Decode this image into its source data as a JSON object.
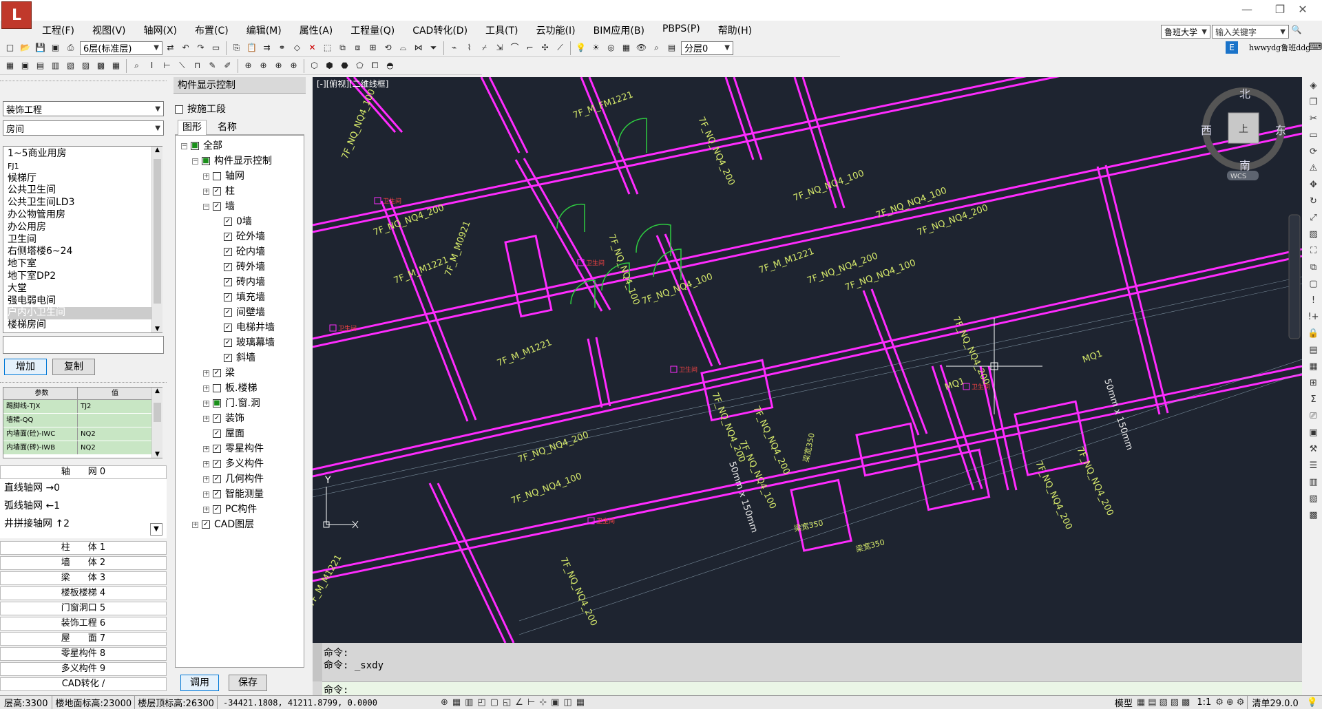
{
  "app": {
    "search_scope": "鲁班大学",
    "search_placeholder": "输入关键字",
    "user_name": "hwwydg鲁班ddg",
    "user_badge": "E"
  },
  "menu": [
    "工程(F)",
    "视图(V)",
    "轴网(X)",
    "布置(C)",
    "编辑(M)",
    "属性(A)",
    "工程量(Q)",
    "CAD转化(D)",
    "工具(T)",
    "云功能(I)",
    "BIM应用(B)",
    "PBPS(P)",
    "帮助(H)"
  ],
  "toolbar": {
    "floor_select": "6层(标准层)",
    "layer_select": "分层0"
  },
  "left": {
    "project_select": "装饰工程",
    "type_select": "房间",
    "rooms": [
      "1~5商业用房",
      "FJ1",
      "候梯厅",
      "公共卫生间",
      "公共卫生间LD3",
      "办公物管用房",
      "办公用房",
      "卫生间",
      "右侧塔楼6~24",
      "地下室",
      "地下室DP2",
      "大堂",
      "强电弱电间",
      "户内小卫生间",
      "楼梯房间"
    ],
    "selected_room": "户内小卫生间",
    "add_button": "增加",
    "copy_button": "复制",
    "param_headers": [
      "参数",
      "值"
    ],
    "params": [
      {
        "name": "踢脚线-TJX",
        "value": "TJ2"
      },
      {
        "name": "墙裙-QQ",
        "value": ""
      },
      {
        "name": "内墙面(砼)-IWC",
        "value": "NQ2"
      },
      {
        "name": "内墙面(砖)-IWB",
        "value": "NQ2"
      }
    ],
    "axis_header": "轴　　网 0",
    "axis_items": [
      "直线轴网 →0",
      "弧线轴网 ←1",
      "井拼接轴网 ↑2"
    ],
    "categories": [
      "柱　　体 1",
      "墙　　体 2",
      "梁　　体 3",
      "楼板楼梯 4",
      "门窗洞口 5",
      "装饰工程 6",
      "屋　　面 7",
      "零星构件 8",
      "多义构件 9",
      "CAD转化 /"
    ]
  },
  "display_panel": {
    "title": "构件显示控制",
    "measure_section": "按施工段",
    "tabs": [
      "图形",
      "名称"
    ],
    "tree": [
      {
        "label": "全部",
        "level": 0,
        "exp": "-",
        "chk": "■"
      },
      {
        "label": "构件显示控制",
        "level": 1,
        "exp": "-",
        "chk": "■"
      },
      {
        "label": "轴网",
        "level": 2,
        "exp": "+",
        "chk": ""
      },
      {
        "label": "柱",
        "level": 2,
        "exp": "+",
        "chk": "✓"
      },
      {
        "label": "墙",
        "level": 2,
        "exp": "-",
        "chk": "✓"
      },
      {
        "label": "0墙",
        "level": 3,
        "exp": "",
        "chk": "✓"
      },
      {
        "label": "砼外墙",
        "level": 3,
        "exp": "",
        "chk": "✓"
      },
      {
        "label": "砼内墙",
        "level": 3,
        "exp": "",
        "chk": "✓"
      },
      {
        "label": "砖外墙",
        "level": 3,
        "exp": "",
        "chk": "✓"
      },
      {
        "label": "砖内墙",
        "level": 3,
        "exp": "",
        "chk": "✓"
      },
      {
        "label": "填充墙",
        "level": 3,
        "exp": "",
        "chk": "✓"
      },
      {
        "label": "间壁墙",
        "level": 3,
        "exp": "",
        "chk": "✓"
      },
      {
        "label": "电梯井墙",
        "level": 3,
        "exp": "",
        "chk": "✓"
      },
      {
        "label": "玻璃幕墙",
        "level": 3,
        "exp": "",
        "chk": "✓"
      },
      {
        "label": "斜墙",
        "level": 3,
        "exp": "",
        "chk": "✓"
      },
      {
        "label": "梁",
        "level": 2,
        "exp": "+",
        "chk": "✓"
      },
      {
        "label": "板.楼梯",
        "level": 2,
        "exp": "+",
        "chk": ""
      },
      {
        "label": "门.窗.洞",
        "level": 2,
        "exp": "+",
        "chk": "■"
      },
      {
        "label": "装饰",
        "level": 2,
        "exp": "+",
        "chk": "✓"
      },
      {
        "label": "屋面",
        "level": 2,
        "exp": "",
        "chk": "✓"
      },
      {
        "label": "零星构件",
        "level": 2,
        "exp": "+",
        "chk": "✓"
      },
      {
        "label": "多义构件",
        "level": 2,
        "exp": "+",
        "chk": "✓"
      },
      {
        "label": "几何构件",
        "level": 2,
        "exp": "+",
        "chk": "✓"
      },
      {
        "label": "智能测量",
        "level": 2,
        "exp": "+",
        "chk": "✓"
      },
      {
        "label": "PC构件",
        "level": 2,
        "exp": "+",
        "chk": "✓"
      },
      {
        "label": "CAD图层",
        "level": 1,
        "exp": "+",
        "chk": "✓"
      }
    ],
    "apply_button": "调用",
    "save_button": "保存"
  },
  "canvas": {
    "view_label": "[-][俯视][二维线框]",
    "compass": {
      "north": "北",
      "south": "南",
      "east": "东",
      "west": "西",
      "center": "上",
      "wcs": "WCS"
    },
    "ucs_y": "Y",
    "labels": [
      "7F_NQ_NQ4_100",
      "7F_NQ_NQ4_200",
      "7F_M_M1221",
      "7F_M_M0921",
      "7F_M_FM1221",
      "7F_NQ_NQ4_100",
      "7F_NQ_NQ4_200",
      "7F_M_M1221",
      "7F_NQ_NQ4_200",
      "7F_NQ_NQ4_100",
      "7F_NQ_NQ4_200",
      "7F_M_M1221",
      "7F_NQ_NQ4_200",
      "7F_NQ_NQ4_100",
      "MQ1",
      "MQ1",
      "MQ1",
      "7F_NQ_NQ4_200",
      "7F_NQ_NQ4_100",
      "7F_NQ_NQ4_200",
      "7F_NQ_NQ4_100",
      "7F_M_M1221",
      "7F_NQ_NQ4_200",
      "7F_NQ_NQ4_200",
      "7F_NQ_NQ4_100",
      "7F_NQ_NQ4_200",
      "7F_NQ_NQ4_100",
      "7F_NQ_NQ4_200"
    ],
    "dim_labels": [
      "50mm x 150mm",
      "50mm x 150mm"
    ],
    "small_labels": [
      "卫生间",
      "卫生间",
      "卫生间",
      "卫生间",
      "卫生间",
      "卫生间"
    ],
    "beam_labels": [
      "梁宽350",
      "梁宽350",
      "梁宽350"
    ]
  },
  "command": {
    "lines": [
      "命令:",
      "命令: _sxdy"
    ],
    "prompt": "命令:"
  },
  "status": {
    "floor_height": "层高:3300",
    "floor_elev": "楼地面标高:23000",
    "top_elev": "楼层顶标高:26300",
    "coords": "-34421.1808,  41211.8799,  0.0000",
    "model_tab": "模型",
    "scale": "1:1",
    "version": "清单29.0.0"
  },
  "colors": {
    "canvas_bg": "#1e2430",
    "wall": "#ff2bff",
    "door": "#2ecc40",
    "cad_text": "#d5e86a"
  }
}
